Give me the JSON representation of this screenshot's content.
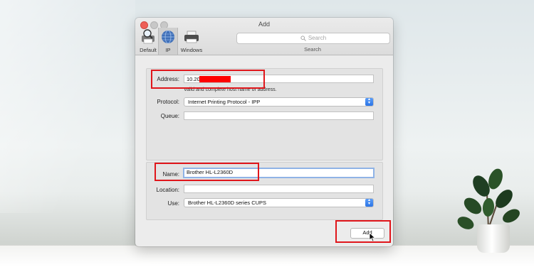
{
  "window": {
    "title": "Add"
  },
  "toolbar": {
    "items": [
      {
        "label": "Default",
        "icon": "printer-magnifier-icon"
      },
      {
        "label": "IP",
        "icon": "globe-icon"
      },
      {
        "label": "Windows",
        "icon": "windows-printer-icon"
      }
    ],
    "search_placeholder": "Search",
    "search_label": "Search"
  },
  "form": {
    "address": {
      "label": "Address:",
      "value": "10.20"
    },
    "hint": "Valid and complete host name or address.",
    "protocol": {
      "label": "Protocol:",
      "value": "Internet Printing Protocol - IPP"
    },
    "queue": {
      "label": "Queue:",
      "value": ""
    },
    "name": {
      "label": "Name:",
      "value": "Brother HL-L2360D"
    },
    "location": {
      "label": "Location:",
      "value": ""
    },
    "use": {
      "label": "Use:",
      "value": "Brother HL-L2360D series CUPS"
    }
  },
  "buttons": {
    "add": "Add"
  },
  "colors": {
    "highlight": "#e0161b",
    "redaction": "#ff0000",
    "accent": "#2b74e6"
  }
}
